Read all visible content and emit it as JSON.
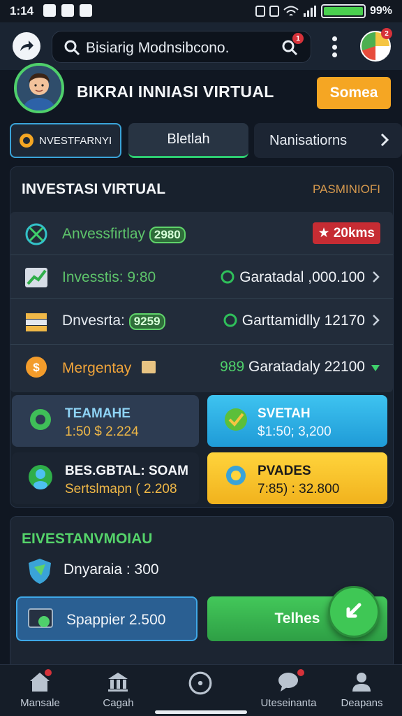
{
  "status_bar": {
    "time": "1:14",
    "battery_text": "99%"
  },
  "app_bar": {
    "search_text": "Bisiarig Modnsibcono.",
    "search_badge": "1",
    "avatar_badge": "2"
  },
  "header": {
    "title": "BIKRAI INNIASI VIRTUAL",
    "action_button": "Somea"
  },
  "tabs": [
    {
      "label": "NVESTFARNYI"
    },
    {
      "label": "Bletlah"
    },
    {
      "label": "Nanisatiorns"
    }
  ],
  "main_panel": {
    "title": "INVESTASI VIRTUAL",
    "label": "PASMINIOFI",
    "rows": [
      {
        "label": "Anvessfirtlay",
        "pill": "2980",
        "badge": "20kms",
        "icon": "target-icon"
      },
      {
        "label": "Invesstis: 9:80",
        "value": "Garatadal ,000.100",
        "icon": "chart-up-icon"
      },
      {
        "label": "Dnvesrta:",
        "pill": "9259",
        "value": "Garttamidlly 12170",
        "icon": "stack-icon"
      },
      {
        "label": "Mergentay",
        "value_prefix": "989",
        "value": "Garatadaly 22100",
        "icon": "coin-icon"
      }
    ],
    "tiles": [
      {
        "title": "TEAMAHE",
        "value": "1:50 $ 2.224",
        "icon": "gear-coin-icon"
      },
      {
        "title": "SVETAH",
        "value": "$1:50; 3,200",
        "icon": "check-shield-icon"
      },
      {
        "title": "BES.GBTAL: SOAM",
        "value": "Sertslmapn ( 2.208",
        "icon": "profile-icon"
      },
      {
        "title": "PVADES",
        "value": "7:85) : 32.800",
        "icon": "award-icon"
      }
    ]
  },
  "panel2": {
    "title": "EIVESTANVMOIAU",
    "row_label": "Dnyaraia : 300",
    "btn_left": "Spappier 2.500",
    "btn_right": "Telhes"
  },
  "bottom_nav": [
    {
      "label": "Mansale",
      "icon": "home-icon"
    },
    {
      "label": "Cagah",
      "icon": "bank-icon"
    },
    {
      "label": "",
      "icon": "globe-icon"
    },
    {
      "label": "Uteseinanta",
      "icon": "chat-icon"
    },
    {
      "label": "Deapans",
      "icon": "person-icon"
    }
  ],
  "colors": {
    "background": "#101722",
    "accent_green": "#4fd06b",
    "accent_orange": "#f5a623",
    "accent_blue": "#3ea8e8",
    "accent_red": "#d6323a"
  }
}
